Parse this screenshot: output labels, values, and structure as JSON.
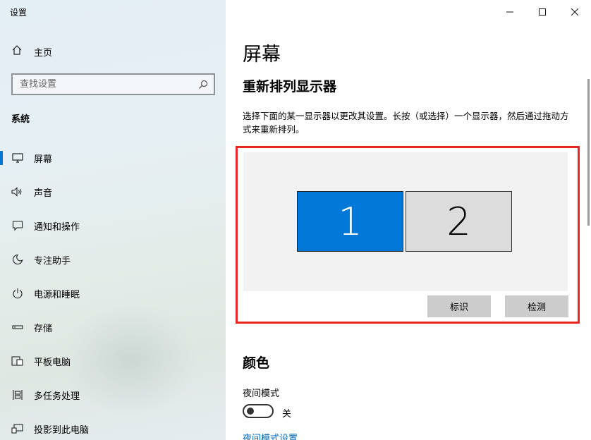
{
  "window": {
    "title": "设置"
  },
  "sidebar": {
    "home_label": "主页",
    "search_placeholder": "查找设置",
    "section": "系统",
    "items": [
      {
        "label": "屏幕",
        "icon": "monitor-icon",
        "active": true
      },
      {
        "label": "声音",
        "icon": "speaker-icon"
      },
      {
        "label": "通知和操作",
        "icon": "notification-icon"
      },
      {
        "label": "专注助手",
        "icon": "moon-icon"
      },
      {
        "label": "电源和睡眠",
        "icon": "power-icon"
      },
      {
        "label": "存储",
        "icon": "storage-icon"
      },
      {
        "label": "平板电脑",
        "icon": "tablet-icon"
      },
      {
        "label": "多任务处理",
        "icon": "multitask-icon"
      },
      {
        "label": "投影到此电脑",
        "icon": "project-icon"
      }
    ]
  },
  "main": {
    "title": "屏幕",
    "rearrange_title": "重新排列显示器",
    "rearrange_desc": "选择下面的某一显示器以更改其设置。长按（或选择）一个显示器，然后通过拖动方式来重新排列。",
    "monitors": [
      {
        "label": "1",
        "selected": true
      },
      {
        "label": "2",
        "selected": false
      }
    ],
    "identify_label": "标识",
    "detect_label": "检测",
    "color_title": "颜色",
    "night_mode_label": "夜间模式",
    "night_mode_state": "关",
    "night_mode_link": "夜间模式设置"
  },
  "colors": {
    "accent": "#0078d7",
    "highlight_border": "#e8261e",
    "link": "#0067b8"
  }
}
